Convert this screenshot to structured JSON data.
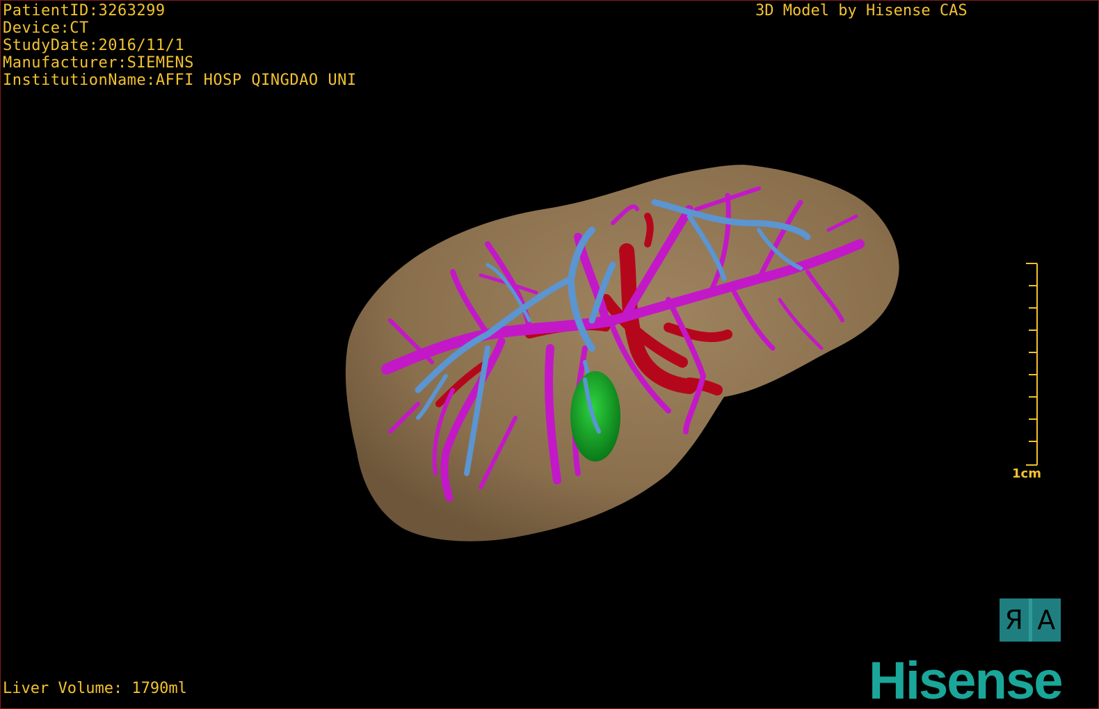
{
  "patient": {
    "id_line": "PatientID:3263299",
    "device_line": "Device:CT",
    "study_date_line": "StudyDate:2016/11/1",
    "manufacturer_line": "Manufacturer:SIEMENS",
    "institution_line": "InstitutionName:AFFI HOSP QINGDAO UNI"
  },
  "model_credit": "3D Model by Hisense CAS",
  "liver_volume": "Liver Volume: 1790ml",
  "scale_bar": {
    "label": "1cm"
  },
  "orientation_marker": {
    "left_glyph": "Я",
    "right_glyph": "A"
  },
  "brand": {
    "name": "Hisense"
  },
  "colors": {
    "text": "#f2c230",
    "liver": "#8c7250",
    "hepatic_vein": "#c318c8",
    "portal_vein": "#5b95d2",
    "artery": "#b5071c",
    "tumor": "#12a226",
    "brand": "#1aa79a"
  }
}
